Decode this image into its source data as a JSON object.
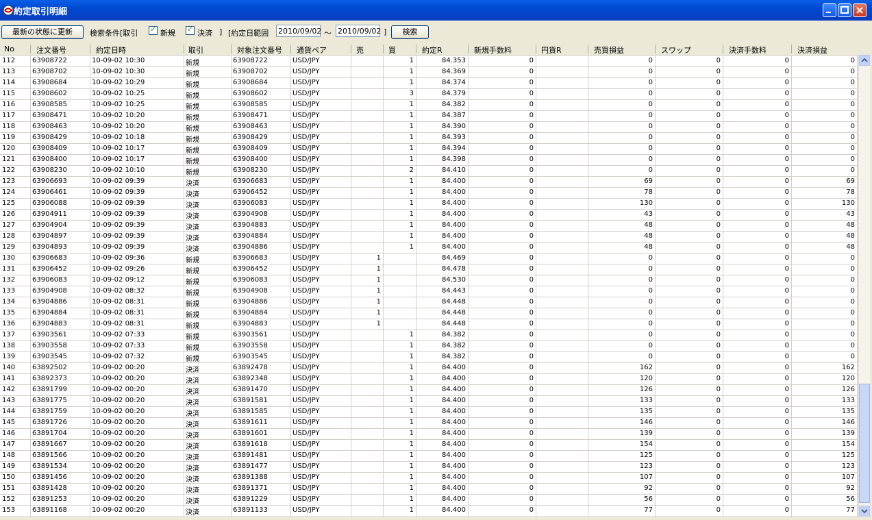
{
  "window": {
    "title": "約定取引明細"
  },
  "toolbar": {
    "refresh_label": "最新の状態に更新",
    "search_cond_label": "検索条件[取引",
    "new_label": "新規",
    "settle_label": "決済",
    "close_bracket": "]",
    "date_range_label": "[約定日範囲",
    "date_from": "2010/09/02",
    "tilde": "～",
    "date_to": "2010/09/02",
    "end_bracket": "]",
    "search_label": "検索"
  },
  "columns": [
    "No",
    "注文番号",
    "約定日時",
    "取引",
    "対象注文番号",
    "通貨ペア",
    "売",
    "買",
    "約定R",
    "新規手数料",
    "円貨R",
    "売買損益",
    "スワップ",
    "決済手数料",
    "決済損益"
  ],
  "rows": [
    [
      "112",
      "63908722",
      "10-09-02 10:30",
      "新規",
      "63908722",
      "USD/JPY",
      "",
      "1",
      "84.353",
      "0",
      "",
      "0",
      "0",
      "0",
      "0"
    ],
    [
      "113",
      "63908702",
      "10-09-02 10:30",
      "新規",
      "63908702",
      "USD/JPY",
      "",
      "1",
      "84.369",
      "0",
      "",
      "0",
      "0",
      "0",
      "0"
    ],
    [
      "114",
      "63908684",
      "10-09-02 10:29",
      "新規",
      "63908684",
      "USD/JPY",
      "",
      "1",
      "84.374",
      "0",
      "",
      "0",
      "0",
      "0",
      "0"
    ],
    [
      "115",
      "63908602",
      "10-09-02 10:25",
      "新規",
      "63908602",
      "USD/JPY",
      "",
      "3",
      "84.379",
      "0",
      "",
      "0",
      "0",
      "0",
      "0"
    ],
    [
      "116",
      "63908585",
      "10-09-02 10:25",
      "新規",
      "63908585",
      "USD/JPY",
      "",
      "1",
      "84.382",
      "0",
      "",
      "0",
      "0",
      "0",
      "0"
    ],
    [
      "117",
      "63908471",
      "10-09-02 10:20",
      "新規",
      "63908471",
      "USD/JPY",
      "",
      "1",
      "84.387",
      "0",
      "",
      "0",
      "0",
      "0",
      "0"
    ],
    [
      "118",
      "63908463",
      "10-09-02 10:20",
      "新規",
      "63908463",
      "USD/JPY",
      "",
      "1",
      "84.390",
      "0",
      "",
      "0",
      "0",
      "0",
      "0"
    ],
    [
      "119",
      "63908429",
      "10-09-02 10:18",
      "新規",
      "63908429",
      "USD/JPY",
      "",
      "1",
      "84.393",
      "0",
      "",
      "0",
      "0",
      "0",
      "0"
    ],
    [
      "120",
      "63908409",
      "10-09-02 10:17",
      "新規",
      "63908409",
      "USD/JPY",
      "",
      "1",
      "84.394",
      "0",
      "",
      "0",
      "0",
      "0",
      "0"
    ],
    [
      "121",
      "63908400",
      "10-09-02 10:17",
      "新規",
      "63908400",
      "USD/JPY",
      "",
      "1",
      "84.398",
      "0",
      "",
      "0",
      "0",
      "0",
      "0"
    ],
    [
      "122",
      "63908230",
      "10-09-02 10:10",
      "新規",
      "63908230",
      "USD/JPY",
      "",
      "2",
      "84.410",
      "0",
      "",
      "0",
      "0",
      "0",
      "0"
    ],
    [
      "123",
      "63906693",
      "10-09-02 09:39",
      "決済",
      "63906683",
      "USD/JPY",
      "",
      "1",
      "84.400",
      "0",
      "",
      "69",
      "0",
      "0",
      "69"
    ],
    [
      "124",
      "63906461",
      "10-09-02 09:39",
      "決済",
      "63906452",
      "USD/JPY",
      "",
      "1",
      "84.400",
      "0",
      "",
      "78",
      "0",
      "0",
      "78"
    ],
    [
      "125",
      "63906088",
      "10-09-02 09:39",
      "決済",
      "63906083",
      "USD/JPY",
      "",
      "1",
      "84.400",
      "0",
      "",
      "130",
      "0",
      "0",
      "130"
    ],
    [
      "126",
      "63904911",
      "10-09-02 09:39",
      "決済",
      "63904908",
      "USD/JPY",
      "",
      "1",
      "84.400",
      "0",
      "",
      "43",
      "0",
      "0",
      "43"
    ],
    [
      "127",
      "63904904",
      "10-09-02 09:39",
      "決済",
      "63904883",
      "USD/JPY",
      "",
      "1",
      "84.400",
      "0",
      "",
      "48",
      "0",
      "0",
      "48"
    ],
    [
      "128",
      "63904897",
      "10-09-02 09:39",
      "決済",
      "63904884",
      "USD/JPY",
      "",
      "1",
      "84.400",
      "0",
      "",
      "48",
      "0",
      "0",
      "48"
    ],
    [
      "129",
      "63904893",
      "10-09-02 09:39",
      "決済",
      "63904886",
      "USD/JPY",
      "",
      "1",
      "84.400",
      "0",
      "",
      "48",
      "0",
      "0",
      "48"
    ],
    [
      "130",
      "63906683",
      "10-09-02 09:36",
      "新規",
      "63906683",
      "USD/JPY",
      "1",
      "",
      "84.469",
      "0",
      "",
      "0",
      "0",
      "0",
      "0"
    ],
    [
      "131",
      "63906452",
      "10-09-02 09:26",
      "新規",
      "63906452",
      "USD/JPY",
      "1",
      "",
      "84.478",
      "0",
      "",
      "0",
      "0",
      "0",
      "0"
    ],
    [
      "132",
      "63906083",
      "10-09-02 09:12",
      "新規",
      "63906083",
      "USD/JPY",
      "1",
      "",
      "84.530",
      "0",
      "",
      "0",
      "0",
      "0",
      "0"
    ],
    [
      "133",
      "63904908",
      "10-09-02 08:32",
      "新規",
      "63904908",
      "USD/JPY",
      "1",
      "",
      "84.443",
      "0",
      "",
      "0",
      "0",
      "0",
      "0"
    ],
    [
      "134",
      "63904886",
      "10-09-02 08:31",
      "新規",
      "63904886",
      "USD/JPY",
      "1",
      "",
      "84.448",
      "0",
      "",
      "0",
      "0",
      "0",
      "0"
    ],
    [
      "135",
      "63904884",
      "10-09-02 08:31",
      "新規",
      "63904884",
      "USD/JPY",
      "1",
      "",
      "84.448",
      "0",
      "",
      "0",
      "0",
      "0",
      "0"
    ],
    [
      "136",
      "63904883",
      "10-09-02 08:31",
      "新規",
      "63904883",
      "USD/JPY",
      "1",
      "",
      "84.448",
      "0",
      "",
      "0",
      "0",
      "0",
      "0"
    ],
    [
      "137",
      "63903561",
      "10-09-02 07:33",
      "新規",
      "63903561",
      "USD/JPY",
      "",
      "1",
      "84.382",
      "0",
      "",
      "0",
      "0",
      "0",
      "0"
    ],
    [
      "138",
      "63903558",
      "10-09-02 07:33",
      "新規",
      "63903558",
      "USD/JPY",
      "",
      "1",
      "84.382",
      "0",
      "",
      "0",
      "0",
      "0",
      "0"
    ],
    [
      "139",
      "63903545",
      "10-09-02 07:32",
      "新規",
      "63903545",
      "USD/JPY",
      "",
      "1",
      "84.382",
      "0",
      "",
      "0",
      "0",
      "0",
      "0"
    ],
    [
      "140",
      "63892502",
      "10-09-02 00:20",
      "決済",
      "63892478",
      "USD/JPY",
      "",
      "1",
      "84.400",
      "0",
      "",
      "162",
      "0",
      "0",
      "162"
    ],
    [
      "141",
      "63892373",
      "10-09-02 00:20",
      "決済",
      "63892348",
      "USD/JPY",
      "",
      "1",
      "84.400",
      "0",
      "",
      "120",
      "0",
      "0",
      "120"
    ],
    [
      "142",
      "63891799",
      "10-09-02 00:20",
      "決済",
      "63891470",
      "USD/JPY",
      "",
      "1",
      "84.400",
      "0",
      "",
      "126",
      "0",
      "0",
      "126"
    ],
    [
      "143",
      "63891775",
      "10-09-02 00:20",
      "決済",
      "63891581",
      "USD/JPY",
      "",
      "1",
      "84.400",
      "0",
      "",
      "133",
      "0",
      "0",
      "133"
    ],
    [
      "144",
      "63891759",
      "10-09-02 00:20",
      "決済",
      "63891585",
      "USD/JPY",
      "",
      "1",
      "84.400",
      "0",
      "",
      "135",
      "0",
      "0",
      "135"
    ],
    [
      "145",
      "63891726",
      "10-09-02 00:20",
      "決済",
      "63891611",
      "USD/JPY",
      "",
      "1",
      "84.400",
      "0",
      "",
      "146",
      "0",
      "0",
      "146"
    ],
    [
      "146",
      "63891704",
      "10-09-02 00:20",
      "決済",
      "63891601",
      "USD/JPY",
      "",
      "1",
      "84.400",
      "0",
      "",
      "139",
      "0",
      "0",
      "139"
    ],
    [
      "147",
      "63891667",
      "10-09-02 00:20",
      "決済",
      "63891618",
      "USD/JPY",
      "",
      "1",
      "84.400",
      "0",
      "",
      "154",
      "0",
      "0",
      "154"
    ],
    [
      "148",
      "63891566",
      "10-09-02 00:20",
      "決済",
      "63891481",
      "USD/JPY",
      "",
      "1",
      "84.400",
      "0",
      "",
      "125",
      "0",
      "0",
      "125"
    ],
    [
      "149",
      "63891534",
      "10-09-02 00:20",
      "決済",
      "63891477",
      "USD/JPY",
      "",
      "1",
      "84.400",
      "0",
      "",
      "123",
      "0",
      "0",
      "123"
    ],
    [
      "150",
      "63891456",
      "10-09-02 00:20",
      "決済",
      "63891388",
      "USD/JPY",
      "",
      "1",
      "84.400",
      "0",
      "",
      "107",
      "0",
      "0",
      "107"
    ],
    [
      "151",
      "63891428",
      "10-09-02 00:20",
      "決済",
      "63891371",
      "USD/JPY",
      "",
      "1",
      "84.400",
      "0",
      "",
      "92",
      "0",
      "0",
      "92"
    ],
    [
      "152",
      "63891253",
      "10-09-02 00:20",
      "決済",
      "63891229",
      "USD/JPY",
      "",
      "1",
      "84.400",
      "0",
      "",
      "56",
      "0",
      "0",
      "56"
    ],
    [
      "153",
      "63891168",
      "10-09-02 00:20",
      "決済",
      "63891133",
      "USD/JPY",
      "",
      "1",
      "84.400",
      "0",
      "",
      "77",
      "0",
      "0",
      "77"
    ]
  ],
  "scrollbar": {
    "up_icon": "arrow-up-icon",
    "down_icon": "arrow-down-icon"
  }
}
